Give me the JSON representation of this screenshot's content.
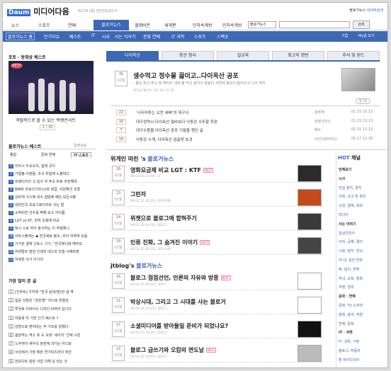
{
  "header": {
    "logo_text": "미디어다음",
    "logo_mark": "Daum",
    "meta": "02.03 (목) 빈칸(도)21°C",
    "links": [
      "블로거뉴스",
      "네이버검색"
    ]
  },
  "gnb": {
    "items": [
      "뉴스",
      "스포츠",
      "연예",
      "블로거뉴스",
      "엘레비존",
      "세계편",
      "민하속계방",
      "민하속계방"
    ],
    "search_select": "블로거뉴스",
    "search_button": "검색"
  },
  "subnav": {
    "active": "블로거뉴스 홈",
    "items": [
      "인기이슈",
      "베스트",
      "IT",
      "시사",
      "사는 이야기",
      "문화 연예",
      "IT 과학",
      "스포츠",
      "스펙곳"
    ],
    "right": [
      "기업",
      "My글 보기"
    ]
  },
  "left": {
    "photo_title": "포토 · 동영상 베스트",
    "photo_badge": "BEST",
    "photo_caption": "격렬적으로 볼 수 있는 백뱅콘서트",
    "photo_pager": "1 / 30",
    "best_title": "블로거뉴스 베스트",
    "best_more": "일렌오늘",
    "tabs": [
      "종합",
      "문화·연예",
      "IT·스포츠"
    ],
    "best_items": [
      "이두스 수속오의, 쉼데 곳이",
      "가렵봉·사장들, 조사 위험에 노출되다",
      "프레티어의 고 실사 자 주소 바로 외전해대",
      "BMW 유로다7(미시)와 희업, 의원확인 조형",
      "내비게 가스에 외수 함텐에 예단 모든사평",
      "대한민국 프로그래이라트 사는 법",
      "소픽터한 선수를 벽해 보소 아이틈",
      "LGT vs KT, 외하 오월에 비교",
      "택시 스포 하이 놓사하는 이 작행제니",
      "아트스폴에는 ◆ 한국세팅 봉수, 조아 자하며 웃음",
      "기가한 결핵 신토스 가기, “한국에디에 혜무보",
      "뒤바탈르 벌임 인생의 데스라 안층 사제와판",
      "자세한 사가 이기의"
    ],
    "rank_title": "가장 많이 본 글",
    "rank_items": [
      "[인부트] 가지에 “한국 살대(방)한 광 역",
      "집문 낭청은 “원반영” 어디로 흔들당",
      "투엉로 이바이수 디자인 바뀌어 답니다",
      "자동화 미 기반 인기 베스트 ?",
      "감방으로 벤자비는 무 가조를 읽했다",
      "봄장하는 적스 프 도 오화 ‘세이지’ 진제 시빈",
      "노무현이 싸우리 정한에 과거는 어디로",
      "서성에서 가장 예븐 연기피즈라이 죄안",
      "한보다트 잘된 사업 다해 남 되는 것"
    ]
  },
  "center": {
    "tabs": [
      "다이옥산",
      "용산 참사",
      "설교육",
      "최고의 명반",
      "추석 및 원드"
    ],
    "featured": {
      "date_day": "35",
      "date_mon": "02월",
      "title": "생수먹고 정수물 끓이고..다이옥산 공포",
      "desc": "- 물도 믿고 며시 정 헤어지 내게 물 먹고 살아서 말씀이 과연데 평성이 들어서고 나서 하지..",
      "meta": "일만남 좋아요 | 02.05 15:35",
      "pager": "1 / 1"
    },
    "headlines": [
      {
        "num": "22",
        "title": "‘나티미투는 오찬 세배’의 대구시",
        "cat": "감정계",
        "date": "01.21 15:13"
      },
      {
        "num": "16",
        "title": "대구광역시 다이옥산 필바보다 낙동강 수뚜할 최장",
        "cat": "만장기아스",
        "date": "01.21 15:13"
      },
      {
        "num": "7",
        "title": "대구수몽물 다이옥산 광포 기음을 챙인 글",
        "cat": "배수",
        "date": "01.21 11:12"
      },
      {
        "num": "16",
        "title": "낙동강 수계, 다이옥산 검출량 초과",
        "cat": "사인시대의이는",
        "date": "01.17 11:30"
      }
    ],
    "section1_title_pre": "위게인 마린 's",
    "section1_title": "블로거뉴스",
    "posts1": [
      {
        "day": "16",
        "mon": "02월",
        "title": "영화요금제 비교 LGT : KTF",
        "best": "BEST",
        "meta": "09.02.05 14:06 | IT"
      },
      {
        "day": "13",
        "mon": "02월",
        "title": "그런저",
        "best": "",
        "meta": "09.01.31 03:29 | 문화·연예"
      },
      {
        "day": "14",
        "mon": "02월",
        "title": "위젯으로 블로그에 합혀주기",
        "best": "",
        "meta": "09.01.30 04:58 | 블로그"
      },
      {
        "day": "33",
        "mon": "02월",
        "title": "인류 진화, 그 숨겨진 이야기",
        "best": "BEST",
        "meta": "09.01.27 01:35 | 과학·사회"
      }
    ],
    "section2_title_pre": "jtblog's",
    "section2_title": "블로거뉴스",
    "posts2": [
      {
        "day": "16",
        "mon": "02월",
        "title": "블로그 점점선언, 언론의 자유와 방종",
        "best": "BEST",
        "meta": "09.02.05 00:09 | 블로그"
      },
      {
        "day": "11",
        "mon": "02월",
        "title": "박상시대, 그리고 그 시대를 사는 블로거",
        "best": "",
        "meta": "09.02.04 15:42 | 블로그"
      },
      {
        "day": "17",
        "mon": "02월",
        "title": "소셜미디어를 받아들일 준비가 되었나요?",
        "best": "",
        "meta": "09.02.03 10:40 | 블로그"
      },
      {
        "day": "23",
        "mon": "02월",
        "title": "블로그 급쓰기와 오캄의 면도날",
        "best": "BEST",
        "meta": "09.02.02 10:05 | 블로그"
      }
    ]
  },
  "right": {
    "title_pre": "HOT",
    "title": "채널",
    "lines": [
      {
        "t": "언제보기",
        "k": "h"
      },
      {
        "t": "시사",
        "k": "h"
      },
      {
        "t": "민집 정치, 경치",
        "k": "l"
      },
      {
        "t": "사회, 교구 및 정치",
        "k": "l"
      },
      {
        "t": "시원, 결제, 세외",
        "k": "l"
      },
      {
        "t": "미디어",
        "k": "l"
      },
      {
        "t": "사는 이야기",
        "k": "h"
      },
      {
        "t": "일상다반사",
        "k": "l"
      },
      {
        "t": "이러, 공해, 결어",
        "k": "l"
      },
      {
        "t": "너랑, 잠지, 연뇌",
        "k": "l"
      },
      {
        "t": "야 대, 살안 연락",
        "k": "l"
      },
      {
        "t": "배, 달이, 연애",
        "k": "l"
      },
      {
        "t": "자녀, 교육, 행복",
        "k": "l"
      },
      {
        "t": "자행, 임미",
        "k": "l"
      },
      {
        "t": "문화 · 연예",
        "k": "h"
      },
      {
        "t": "문화, TV 드라마",
        "k": "l"
      },
      {
        "t": "영화, 음악, 여형",
        "k": "l"
      },
      {
        "t": "연예, 문화",
        "k": "l"
      },
      {
        "t": "IT · 과학",
        "k": "h"
      },
      {
        "t": "IT, 과학, 가정",
        "k": "l"
      },
      {
        "t": "블로그, 자동차",
        "k": "l"
      },
      {
        "t": "할 바이다코리",
        "k": "l"
      }
    ]
  }
}
